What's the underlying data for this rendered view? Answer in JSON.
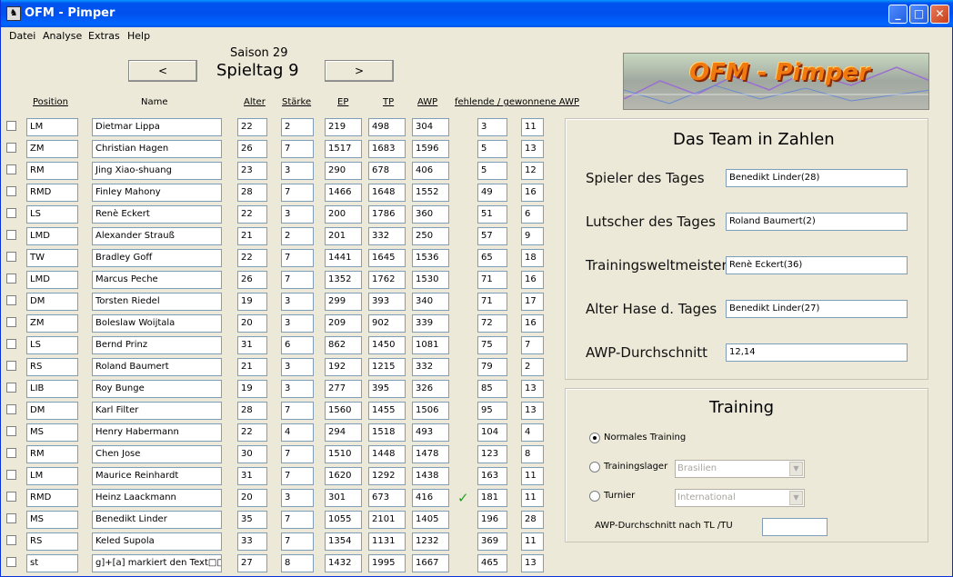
{
  "window": {
    "title": "OFM - Pimper"
  },
  "menu": [
    "Datei",
    "Analyse",
    "Extras",
    "Help"
  ],
  "season_label": "Saison 29",
  "matchday_label": "Spieltag  9",
  "nav": {
    "prev": "<",
    "next": ">"
  },
  "logo_text": "OFM - Pimper",
  "columns": {
    "position": "Position",
    "name": "Name",
    "alter": "Alter",
    "staerke": "Stärke",
    "ep": "EP",
    "tp": "TP",
    "awp": "AWP",
    "fehlende": "fehlende / gewonnene AWP"
  },
  "players": [
    {
      "pos": "LM",
      "name": "Dietmar Lippa",
      "alter": "22",
      "st": "2",
      "ep": "219",
      "tp": "498",
      "awp": "304",
      "f": "3",
      "g": "11",
      "check": false
    },
    {
      "pos": "ZM",
      "name": "Christian Hagen",
      "alter": "26",
      "st": "7",
      "ep": "1517",
      "tp": "1683",
      "awp": "1596",
      "f": "5",
      "g": "13",
      "check": false
    },
    {
      "pos": "RM",
      "name": "Jing Xiao-shuang",
      "alter": "23",
      "st": "3",
      "ep": "290",
      "tp": "678",
      "awp": "406",
      "f": "5",
      "g": "12",
      "check": false
    },
    {
      "pos": "RMD",
      "name": "Finley Mahony",
      "alter": "28",
      "st": "7",
      "ep": "1466",
      "tp": "1648",
      "awp": "1552",
      "f": "49",
      "g": "16",
      "check": false
    },
    {
      "pos": "LS",
      "name": "Renè Eckert",
      "alter": "22",
      "st": "3",
      "ep": "200",
      "tp": "1786",
      "awp": "360",
      "f": "51",
      "g": "6",
      "check": false
    },
    {
      "pos": "LMD",
      "name": "Alexander Strauß",
      "alter": "21",
      "st": "2",
      "ep": "201",
      "tp": "332",
      "awp": "250",
      "f": "57",
      "g": "9",
      "check": false
    },
    {
      "pos": "TW",
      "name": "Bradley Goff",
      "alter": "22",
      "st": "7",
      "ep": "1441",
      "tp": "1645",
      "awp": "1536",
      "f": "65",
      "g": "18",
      "check": false
    },
    {
      "pos": "LMD",
      "name": "Marcus Peche",
      "alter": "26",
      "st": "7",
      "ep": "1352",
      "tp": "1762",
      "awp": "1530",
      "f": "71",
      "g": "16",
      "check": false
    },
    {
      "pos": "DM",
      "name": "Torsten Riedel",
      "alter": "19",
      "st": "3",
      "ep": "299",
      "tp": "393",
      "awp": "340",
      "f": "71",
      "g": "17",
      "check": false
    },
    {
      "pos": "ZM",
      "name": "Boleslaw Woijtala",
      "alter": "20",
      "st": "3",
      "ep": "209",
      "tp": "902",
      "awp": "339",
      "f": "72",
      "g": "16",
      "check": false
    },
    {
      "pos": "LS",
      "name": "Bernd Prinz",
      "alter": "31",
      "st": "6",
      "ep": "862",
      "tp": "1450",
      "awp": "1081",
      "f": "75",
      "g": "7",
      "check": false
    },
    {
      "pos": "RS",
      "name": "Roland Baumert",
      "alter": "21",
      "st": "3",
      "ep": "192",
      "tp": "1215",
      "awp": "332",
      "f": "79",
      "g": "2",
      "check": false
    },
    {
      "pos": "LIB",
      "name": "Roy Bunge",
      "alter": "19",
      "st": "3",
      "ep": "277",
      "tp": "395",
      "awp": "326",
      "f": "85",
      "g": "13",
      "check": false
    },
    {
      "pos": "DM",
      "name": "Karl Filter",
      "alter": "28",
      "st": "7",
      "ep": "1560",
      "tp": "1455",
      "awp": "1506",
      "f": "95",
      "g": "13",
      "check": false
    },
    {
      "pos": "MS",
      "name": "Henry Habermann",
      "alter": "22",
      "st": "4",
      "ep": "294",
      "tp": "1518",
      "awp": "493",
      "f": "104",
      "g": "4",
      "check": false
    },
    {
      "pos": "RM",
      "name": "Chen Jose",
      "alter": "30",
      "st": "7",
      "ep": "1510",
      "tp": "1448",
      "awp": "1478",
      "f": "123",
      "g": "8",
      "check": false
    },
    {
      "pos": "LM",
      "name": "Maurice Reinhardt",
      "alter": "31",
      "st": "7",
      "ep": "1620",
      "tp": "1292",
      "awp": "1438",
      "f": "163",
      "g": "11",
      "check": false
    },
    {
      "pos": "RMD",
      "name": "Heinz Laackmann",
      "alter": "20",
      "st": "3",
      "ep": "301",
      "tp": "673",
      "awp": "416",
      "f": "181",
      "g": "11",
      "check": true
    },
    {
      "pos": "MS",
      "name": "Benedikt Linder",
      "alter": "35",
      "st": "7",
      "ep": "1055",
      "tp": "2101",
      "awp": "1405",
      "f": "196",
      "g": "28",
      "check": false
    },
    {
      "pos": "RS",
      "name": "Keled Supola",
      "alter": "33",
      "st": "7",
      "ep": "1354",
      "tp": "1131",
      "awp": "1232",
      "f": "369",
      "g": "11",
      "check": false
    },
    {
      "pos": "st",
      "name": "g]+[a] markiert den Text□□",
      "alter": "27",
      "st": "8",
      "ep": "1432",
      "tp": "1995",
      "awp": "1667",
      "f": "465",
      "g": "13",
      "check": false
    }
  ],
  "team": {
    "title": "Das Team in Zahlen",
    "stats": [
      {
        "label": "Spieler des Tages",
        "value": "Benedikt Linder(28)"
      },
      {
        "label": "Lutscher des Tages",
        "value": "Roland Baumert(2)"
      },
      {
        "label": "Trainingsweltmeister",
        "value": "Renè Eckert(36)"
      },
      {
        "label": "Alter Hase d. Tages",
        "value": "Benedikt Linder(27)"
      },
      {
        "label": "AWP-Durchschnitt",
        "value": "12,14"
      }
    ]
  },
  "training": {
    "title": "Training",
    "normal": "Normales Training",
    "lager": "Trainingslager",
    "lager_value": "Brasilien",
    "turnier": "Turnier",
    "turnier_value": "International",
    "avg_label": "AWP-Durchschnitt nach TL /TU",
    "avg_value": ""
  },
  "colors": {
    "titlebar": "#0054e3",
    "window_bg": "#ece9d8",
    "checkmark": "#21a121"
  }
}
